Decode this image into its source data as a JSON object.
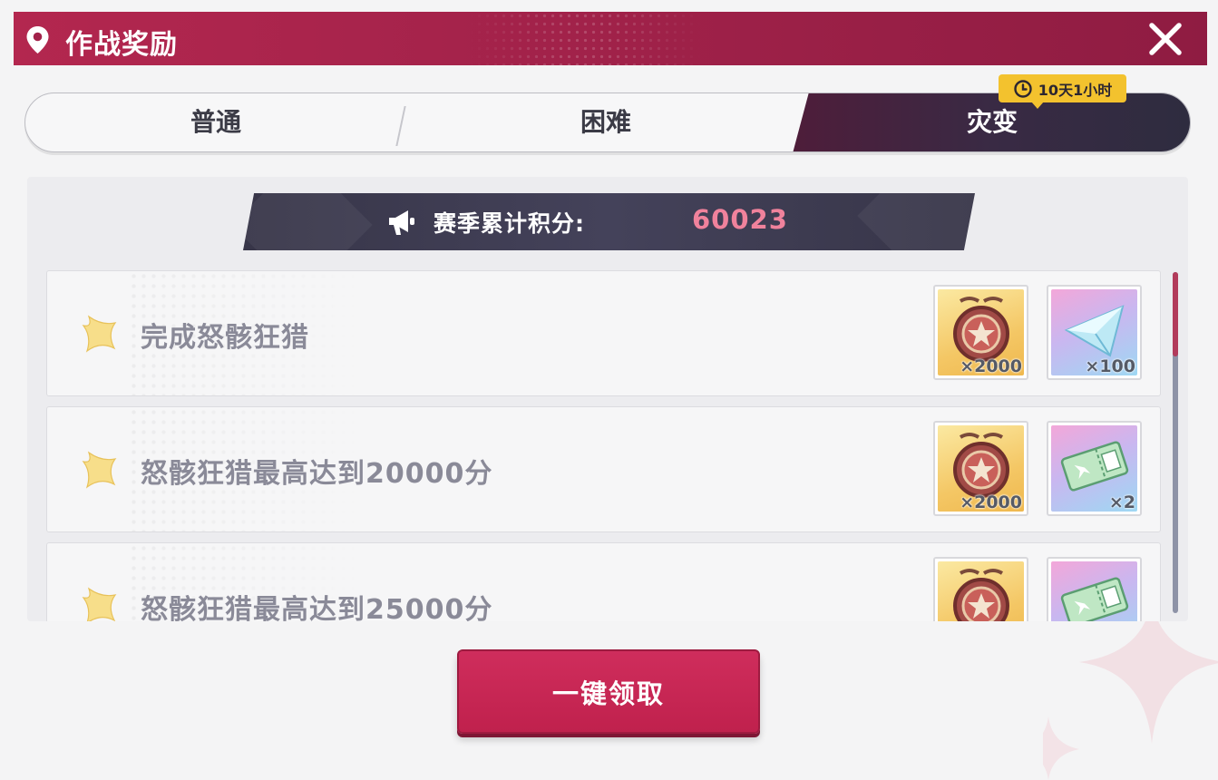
{
  "header": {
    "title": "作战奖励"
  },
  "tabs": [
    {
      "label": "普通"
    },
    {
      "label": "困难"
    },
    {
      "label": "灾变"
    }
  ],
  "timer": {
    "text": "10天1小时"
  },
  "score": {
    "label": "赛季累计积分:",
    "value": "60023"
  },
  "tasks": [
    {
      "title": "完成怒骸狂猎",
      "rewards": [
        {
          "icon": "medal-coin-icon",
          "qty": "×2000"
        },
        {
          "icon": "crystal-icon",
          "qty": "×100"
        }
      ]
    },
    {
      "title": "怒骸狂猎最高达到20000分",
      "rewards": [
        {
          "icon": "medal-coin-icon",
          "qty": "×2000"
        },
        {
          "icon": "ticket-icon",
          "qty": "×2"
        }
      ]
    },
    {
      "title": "怒骸狂猎最高达到25000分",
      "rewards": [
        {
          "icon": "medal-coin-icon",
          "qty": ""
        },
        {
          "icon": "ticket-icon",
          "qty": ""
        }
      ]
    }
  ],
  "claim_button": {
    "label": "一键领取"
  },
  "colors": {
    "accent": "#b3274f",
    "score": "#f0829c",
    "timer": "#f3c22e",
    "dark": "#373548"
  }
}
